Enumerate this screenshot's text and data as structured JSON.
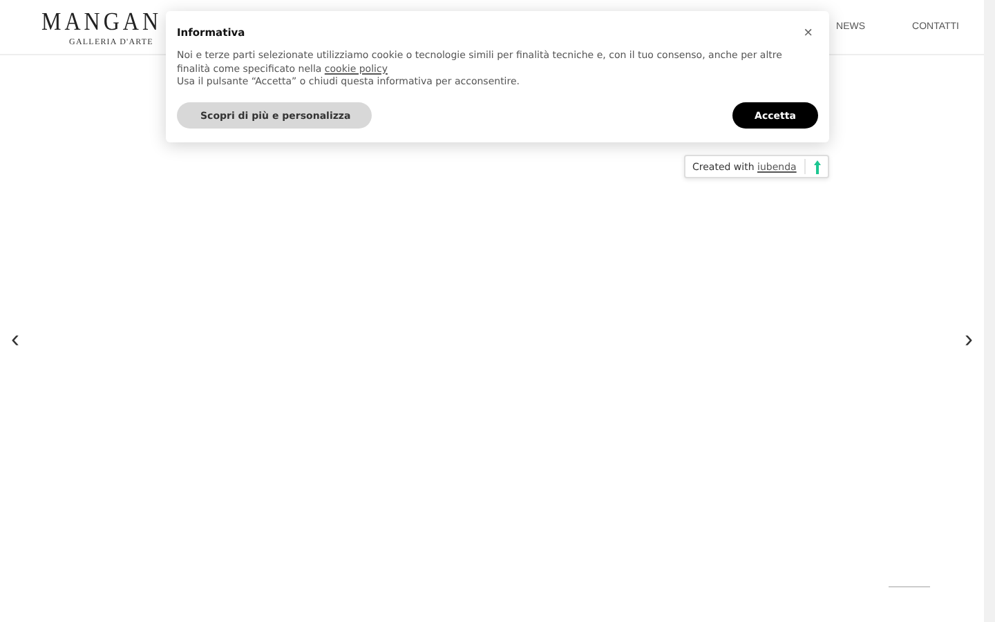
{
  "header": {
    "logo": "MANGAN",
    "tagline": "GALLERIA D'ARTE",
    "nav": [
      "NEWS",
      "CONTATTI"
    ]
  },
  "cookie_banner": {
    "title": "Informativa",
    "close": "×",
    "text_1": "Noi e terze parti selezionate utilizziamo cookie o tecnologie simili per finalità tecniche e, con il tuo consenso, anche per altre finalità come specificato nella ",
    "link": "cookie policy",
    "text_2": "Usa il pulsante “Accetta” o chiudi questa informativa per acconsentire.",
    "buttons": [
      {
        "label": "Scopri di più e personalizza",
        "kind": "secondary"
      },
      {
        "label": "Accetta",
        "kind": "primary"
      }
    ],
    "credit": {
      "text": "Created with ",
      "link": "iubenda"
    }
  },
  "slider": {
    "prev": "‹",
    "next": "›"
  }
}
